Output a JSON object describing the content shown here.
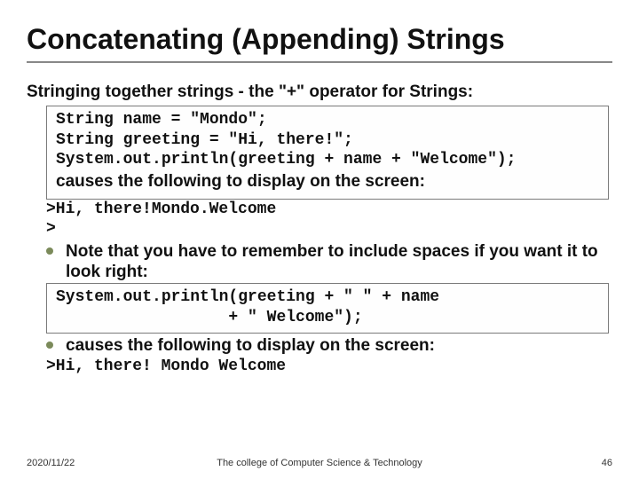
{
  "title": "Concatenating (Appending) Strings",
  "subtitle": "Stringing together strings - the \"+\" operator for Strings:",
  "code1": {
    "line1": "String name = \"Mondo\";",
    "line2": "String greeting = \"Hi, there!\";",
    "line3": "System.out.println(greeting + name + \"Welcome\");"
  },
  "caption1": "causes the following to display on the screen:",
  "output1": {
    "line1": ">Hi, there!Mondo.Welcome",
    "line2": ">"
  },
  "bullet1": "Note that you have to remember to include spaces if you want it to look right:",
  "code2": {
    "line1": "System.out.println(greeting + \" \" + name",
    "line2": "                  + \" Welcome\");"
  },
  "bullet2": "causes the following to display on the screen:",
  "output2": ">Hi, there! Mondo Welcome",
  "footer": {
    "date": "2020/11/22",
    "center": "The college of Computer Science & Technology",
    "page": "46"
  }
}
